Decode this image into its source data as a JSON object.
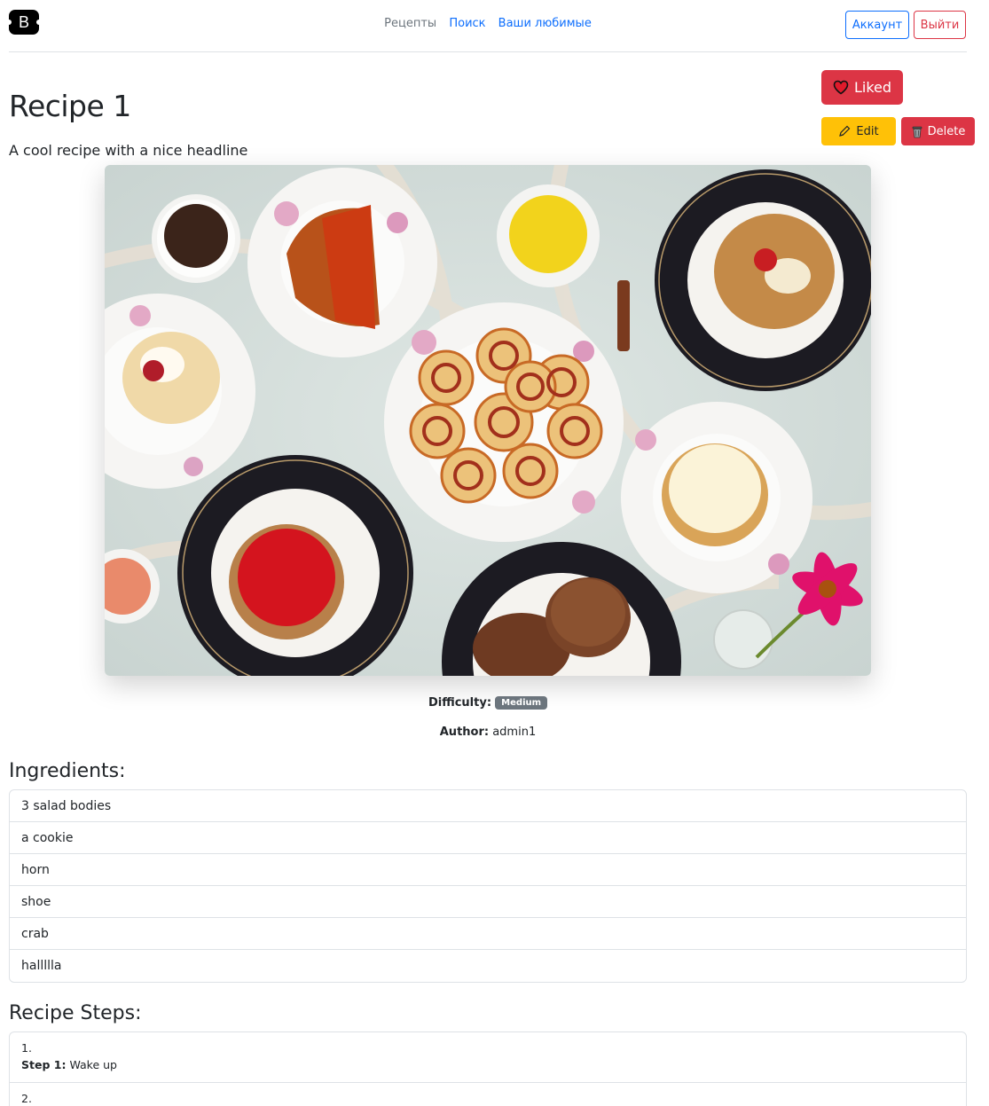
{
  "header": {
    "logo_letter": "B",
    "nav": [
      {
        "label": "Рецепты",
        "active": true
      },
      {
        "label": "Поиск",
        "active": false
      },
      {
        "label": "Ваши любимые",
        "active": false
      }
    ],
    "account_label": "Аккаунт",
    "logout_label": "Выйти"
  },
  "recipe": {
    "title": "Recipe 1",
    "subtitle": "A cool recipe with a nice headline",
    "liked_label": "Liked",
    "edit_label": "Edit",
    "delete_label": "Delete",
    "difficulty_label": "Difficulty:",
    "difficulty_value": "Medium",
    "author_label": "Author:",
    "author_value": "admin1"
  },
  "ingredients": {
    "heading": "Ingredients:",
    "items": [
      "3 salad bodies",
      "a cookie",
      "horn",
      "shoe",
      "crab",
      "hallllla"
    ]
  },
  "steps": {
    "heading": "Recipe Steps:",
    "items": [
      {
        "num": "1.",
        "label": "Step 1:",
        "text": "Wake up"
      },
      {
        "num": "2.",
        "label": "",
        "text": ""
      }
    ]
  },
  "colors": {
    "primary": "#0d6efd",
    "danger": "#dc3545",
    "warning": "#ffc107",
    "secondary": "#6c757d"
  }
}
